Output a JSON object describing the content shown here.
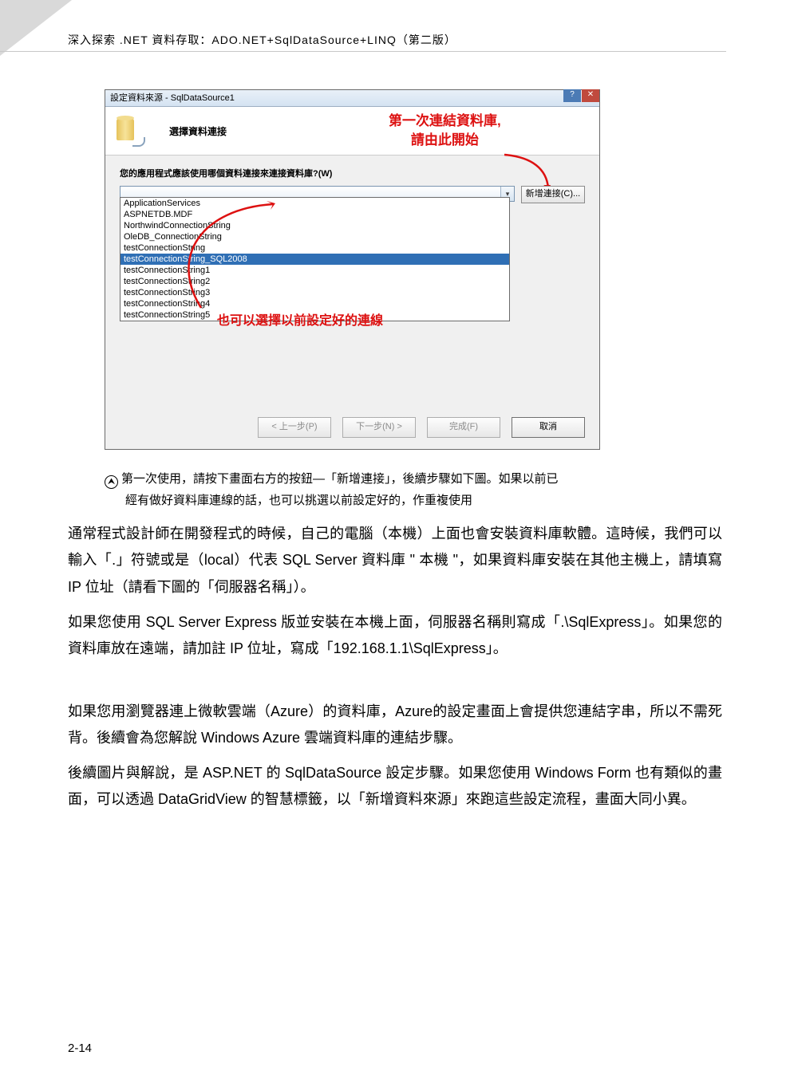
{
  "page": {
    "header": "深入探索 .NET 資料存取：ADO.NET+SqlDataSource+LINQ（第二版）",
    "number": "2-14"
  },
  "dialog": {
    "title": "設定資料來源 - SqlDataSource1",
    "wizard_title": "選擇資料連接",
    "prompt": "您的應用程式應該使用哪個資料連接來連接資料庫?(W)",
    "new_connection_btn": "新增連接(C)...",
    "items": [
      "ApplicationServices",
      "ASPNETDB.MDF",
      "NorthwindConnectionString",
      "OleDB_ConnectionString",
      "testConnectionString",
      "testConnectionString_SQL2008",
      "testConnectionString1",
      "testConnectionString2",
      "testConnectionString3",
      "testConnectionString4",
      "testConnectionString5"
    ],
    "selected_index": 5,
    "buttons": {
      "prev": "< 上一步(P)",
      "next": "下一步(N) >",
      "finish": "完成(F)",
      "cancel": "取消"
    }
  },
  "annotations": {
    "top_line1": "第一次連結資料庫,",
    "top_line2": "請由此開始",
    "mid": "也可以選擇以前設定好的連線"
  },
  "caption": {
    "line1": "第一次使用，請按下畫面右方的按鈕—「新增連接」，後續步驟如下圖。如果以前已",
    "line2": "經有做好資料庫連線的話，也可以挑選以前設定好的，作重複使用"
  },
  "paragraphs": {
    "p1": "通常程式設計師在開發程式的時候，自己的電腦（本機）上面也會安裝資料庫軟體。這時候，我們可以輸入「.」符號或是（local）代表 SQL Server 資料庫 \" 本機 \"，如果資料庫安裝在其他主機上，請填寫 IP 位址（請看下圖的「伺服器名稱」）。",
    "p2": "如果您使用 SQL Server Express 版並安裝在本機上面，伺服器名稱則寫成「.\\SqlExpress」。如果您的資料庫放在遠端，請加註 IP 位址，寫成「192.168.1.1\\SqlExpress」。",
    "p3": "如果您用瀏覽器連上微軟雲端（Azure）的資料庫，Azure的設定畫面上會提供您連結字串，所以不需死背。後續會為您解說 Windows Azure 雲端資料庫的連結步驟。",
    "p4": "後續圖片與解說，是 ASP.NET 的 SqlDataSource 設定步驟。如果您使用 Windows Form 也有類似的畫面，可以透過 DataGridView 的智慧標籤，以「新增資料來源」來跑這些設定流程，畫面大同小異。"
  }
}
